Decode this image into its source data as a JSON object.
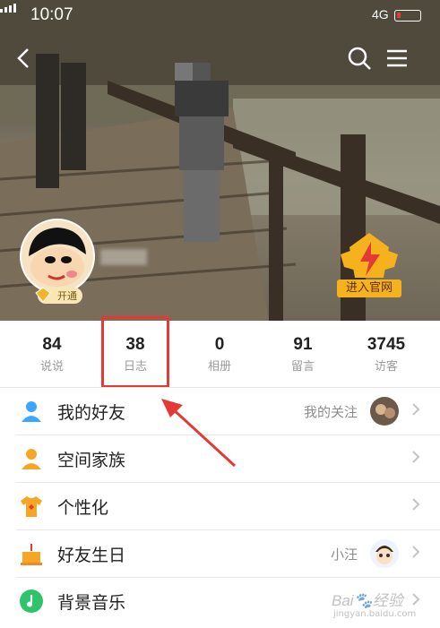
{
  "status_bar": {
    "time": "10:07",
    "network": "4G"
  },
  "header": {
    "back_icon": "chevron-left-icon",
    "search_icon": "search-icon",
    "menu_icon": "menu-icon"
  },
  "profile": {
    "vip_badge": "开通",
    "official_label": "进入官网"
  },
  "stats": [
    {
      "num": "84",
      "label": "说说"
    },
    {
      "num": "38",
      "label": "日志"
    },
    {
      "num": "0",
      "label": "相册"
    },
    {
      "num": "91",
      "label": "留言"
    },
    {
      "num": "3745",
      "label": "访客"
    }
  ],
  "menu": [
    {
      "label": "我的好友",
      "right_text": "我的关注",
      "icon": "friends-icon",
      "icon_color": "#3aa6ff"
    },
    {
      "label": "空间家族",
      "right_text": "",
      "icon": "family-icon",
      "icon_color": "#f5a623"
    },
    {
      "label": "个性化",
      "right_text": "",
      "icon": "tshirt-icon",
      "icon_color": "#f5a623"
    },
    {
      "label": "好友生日",
      "right_text": "小汪",
      "icon": "cake-icon",
      "icon_color": "#f5a623"
    },
    {
      "label": "背景音乐",
      "right_text": "",
      "icon": "music-icon",
      "icon_color": "#2fc46b"
    }
  ],
  "watermark": {
    "brand": "Bai",
    "brand2": "经验",
    "url": "jingyan.baidu.com"
  },
  "colors": {
    "annotation": "#e53935",
    "accent": "#f6b21c"
  }
}
